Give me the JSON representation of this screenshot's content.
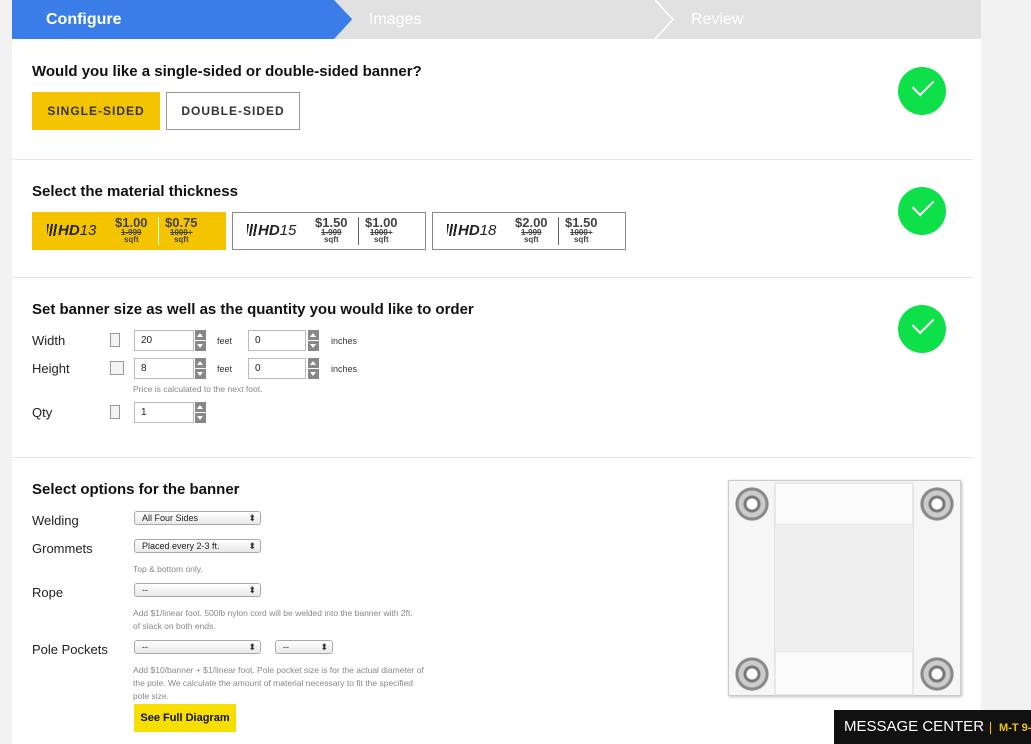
{
  "steps": [
    {
      "label": "Configure"
    },
    {
      "label": "Images"
    },
    {
      "label": "Review"
    }
  ],
  "sides": {
    "question": "Would you like a single-sided or double-sided banner?",
    "options": [
      "SINGLE-SIDED",
      "DOUBLE-SIDED"
    ],
    "selected": "SINGLE-SIDED"
  },
  "material": {
    "title": "Select the material thickness",
    "options": [
      {
        "brand": "HD",
        "num": "13",
        "price1": "$1.00",
        "qty1": "1-999",
        "unit1": "sqft",
        "price2": "$0.75",
        "qty2": "1000+",
        "unit2": "sqft"
      },
      {
        "brand": "HD",
        "num": "15",
        "price1": "$1.50",
        "qty1": "1-999",
        "unit1": "sqft",
        "price2": "$1.00",
        "qty2": "1000+",
        "unit2": "sqft"
      },
      {
        "brand": "HD",
        "num": "18",
        "price1": "$2.00",
        "qty1": "1-999",
        "unit1": "sqft",
        "price2": "$1.50",
        "qty2": "1000+",
        "unit2": "sqft"
      }
    ],
    "selected_index": 0
  },
  "size": {
    "title": "Set banner size as well as the quantity you would like to order",
    "width_label": "Width",
    "width_feet": "20",
    "width_inches": "0",
    "height_label": "Height",
    "height_feet": "8",
    "height_inches": "0",
    "feet_unit": "feet",
    "inches_unit": "inches",
    "price_hint": "Price is calculated to the next foot.",
    "qty_label": "Qty",
    "qty": "1"
  },
  "options": {
    "title": "Select options for the banner",
    "welding_label": "Welding",
    "welding_value": "All Four Sides",
    "grommets_label": "Grommets",
    "grommets_value": "Placed every 2-3 ft.",
    "grommets_hint": "Top & bottom only.",
    "rope_label": "Rope",
    "rope_value": "--",
    "rope_hint_1": "Add $1/linear foot. 500lb nylon cord will be welded into the banner with 2ft.",
    "rope_hint_2": "of slack on both ends.",
    "pole_label": "Pole Pockets",
    "pole_value_1": "--",
    "pole_value_2": "--",
    "pole_hint_1": "Add $10/banner + $1/linear foot. Pole pocket size is for the actual diameter of",
    "pole_hint_2": "the pole. We calculate the amount of material necessary to fit the specified",
    "pole_hint_3": "pole size.",
    "diagram_button": "See Full Diagram"
  },
  "message_center": {
    "label": "MESSAGE CENTER",
    "hours": "M-T 9-"
  },
  "colors": {
    "accent_blue": "#3a7de8",
    "selected_yellow": "#f5c400",
    "check_green": "#0ee04a"
  }
}
